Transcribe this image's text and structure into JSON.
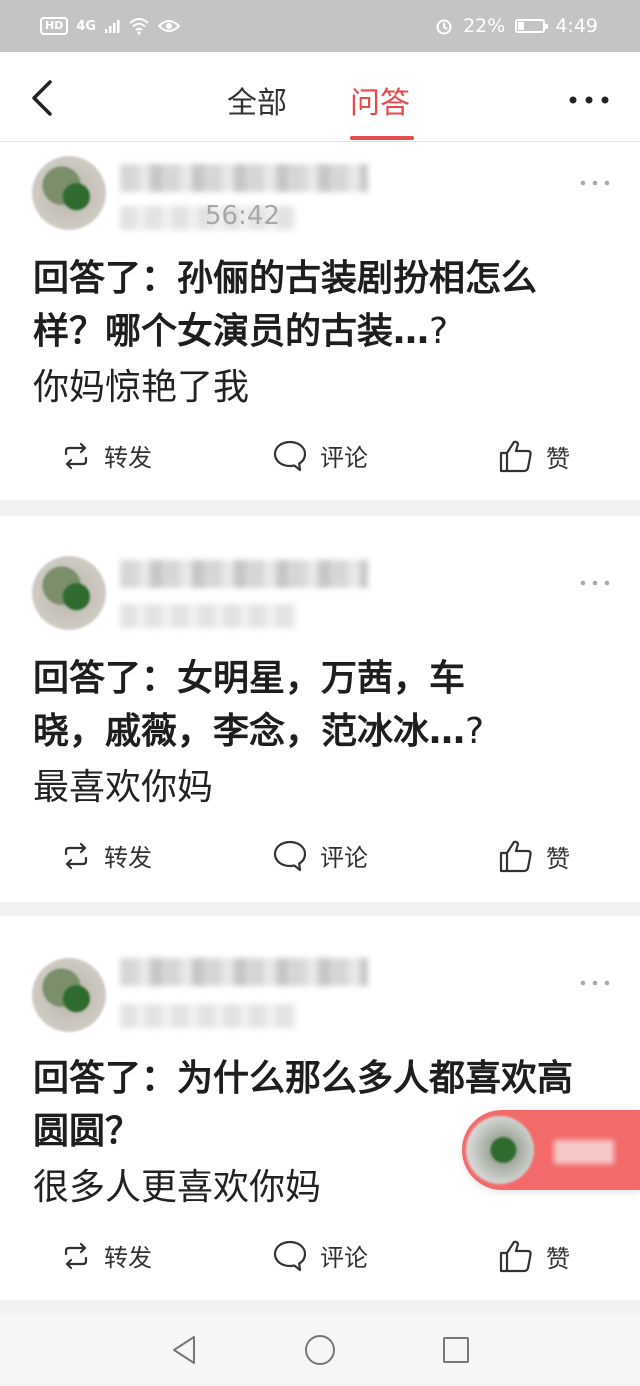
{
  "status_bar": {
    "hd_badge": "HD",
    "network": "4G",
    "battery_percent": "22%",
    "battery_level": 0.22,
    "time": "4:49"
  },
  "header": {
    "tabs": [
      {
        "label": "全部",
        "active": false
      },
      {
        "label": "问答",
        "active": true
      }
    ],
    "accent_color": "#e64a4a"
  },
  "feed": {
    "cards": [
      {
        "time_partial": "56:42",
        "title": "回答了：孙俪的古装剧扮相怎么样？哪个女演员的古装…",
        "title_suffix": "?",
        "answer": "你妈惊艳了我"
      },
      {
        "time_partial": "",
        "title": "回答了：女明星，万茜，车晓，戚薇，李念，范冰冰…",
        "title_suffix": "?",
        "answer": "最喜欢你妈"
      },
      {
        "time_partial": "",
        "title": "回答了：为什么那么多人都喜欢高圆圆？",
        "title_suffix": "",
        "answer": "很多人更喜欢你妈"
      }
    ],
    "actions": {
      "forward": "转发",
      "comment": "评论",
      "like": "赞"
    }
  },
  "icons": {
    "back": "chevron-left-icon",
    "more": "ellipsis-icon",
    "forward": "repost-icon",
    "comment": "comment-bubble-icon",
    "like": "thumbs-up-icon"
  }
}
